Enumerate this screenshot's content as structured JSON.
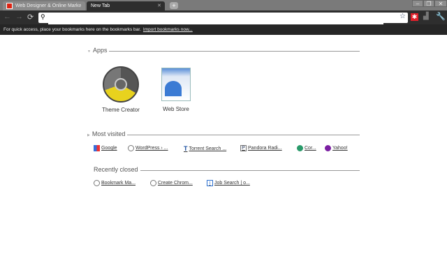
{
  "tabs": [
    {
      "label": "Web Designer & Online Marke",
      "active": false
    },
    {
      "label": "New Tab",
      "active": true
    }
  ],
  "omnibox": {
    "value": "",
    "placeholder": ""
  },
  "bookmarks_bar": {
    "message": "For quick access, place your bookmarks here on the bookmarks bar.",
    "import_link": "Import bookmarks now..."
  },
  "apps": {
    "title": "Apps",
    "items": [
      {
        "label": "Theme Creator",
        "icon": "chrome-theme-icon"
      },
      {
        "label": "Web Store",
        "icon": "web-store-icon"
      }
    ]
  },
  "most_visited": {
    "title": "Most visited",
    "items": [
      {
        "label": "Google",
        "icon": "google-icon"
      },
      {
        "label": "WordPress › ...",
        "icon": "wordpress-icon"
      },
      {
        "label": "Torrent Search ...",
        "icon": "torrent-icon"
      },
      {
        "label": "Pandora Radi...",
        "icon": "pandora-icon"
      },
      {
        "label": "Cor...",
        "icon": "globe-icon"
      },
      {
        "label": "Yahoo!",
        "icon": "yahoo-icon"
      }
    ]
  },
  "recently_closed": {
    "title": "Recently closed",
    "items": [
      {
        "label": "Bookmark Ma...",
        "icon": "globe-icon"
      },
      {
        "label": "Create Chrom...",
        "icon": "globe-icon"
      },
      {
        "label": "Job Search | o...",
        "icon": "info-icon"
      }
    ]
  },
  "colors": {
    "frame": "#7a7a7a",
    "toolbar": "#2e2e2e",
    "bookmark_bar": "#262626",
    "extension": "#e0202a"
  }
}
